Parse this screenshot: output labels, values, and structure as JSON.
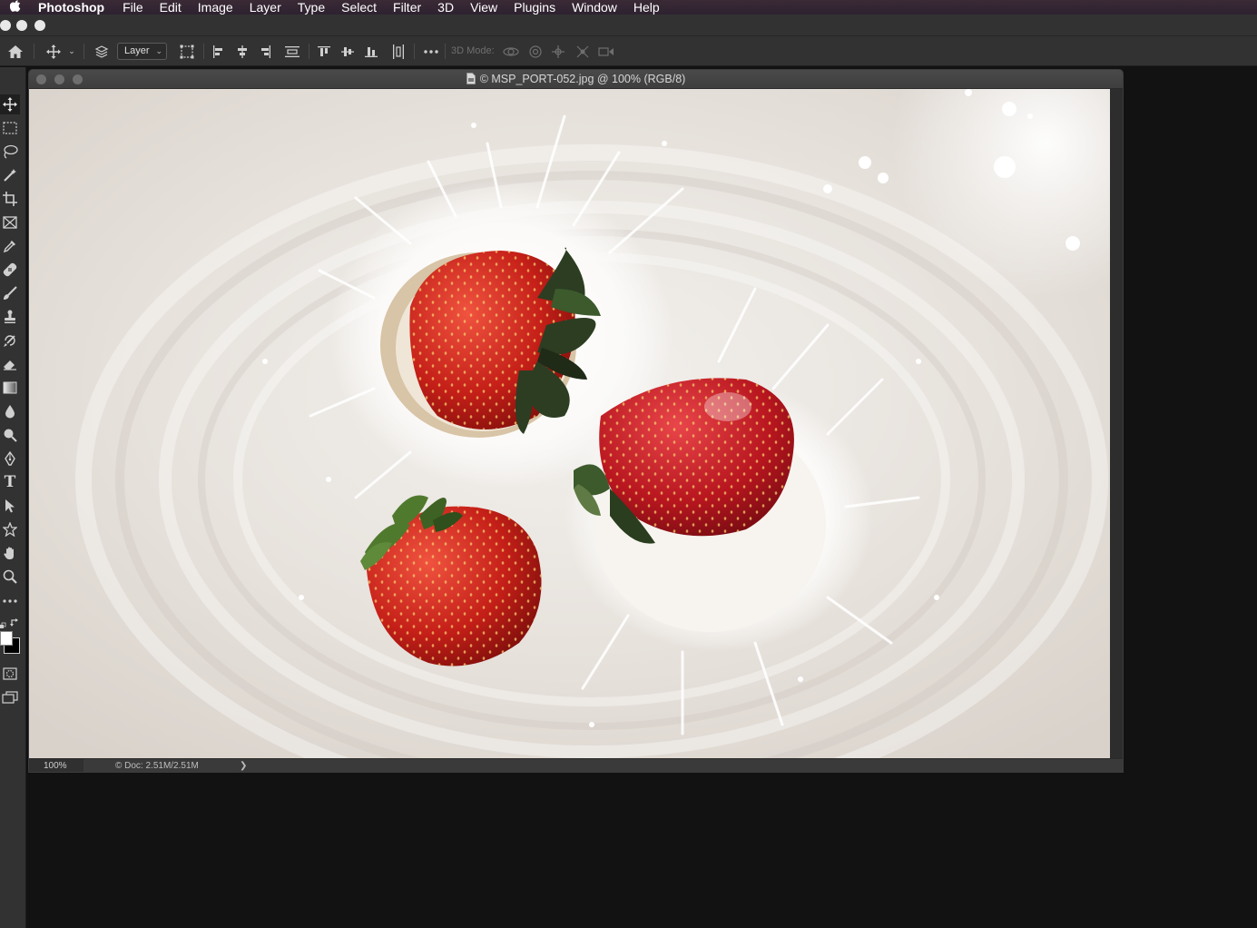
{
  "menubar": {
    "apple_icon": "apple-logo-icon",
    "app_name": "Photoshop",
    "items": [
      "File",
      "Edit",
      "Image",
      "Layer",
      "Type",
      "Select",
      "Filter",
      "3D",
      "View",
      "Plugins",
      "Window",
      "Help"
    ]
  },
  "options_bar": {
    "auto_select_target": "Layer",
    "mode_3d_label": "3D Mode:",
    "icons": [
      "home-icon",
      "move-tool-icon",
      "auto-select-layers-icon",
      "transform-controls-icon",
      "align-left-icon",
      "align-horizontal-center-icon",
      "align-right-icon",
      "distribute-vertical-icon",
      "align-top-icon",
      "align-vertical-center-icon",
      "align-bottom-icon",
      "distribute-horizontal-icon",
      "more-options-icon",
      "orbit-3d-icon",
      "roll-3d-icon",
      "pan-3d-icon",
      "slide-3d-icon",
      "scale-3d-icon"
    ]
  },
  "toolbar": {
    "tools": [
      "move-tool",
      "rectangular-marquee-tool",
      "lasso-tool",
      "magic-wand-tool",
      "crop-tool",
      "frame-tool",
      "eyedropper-tool",
      "healing-brush-tool",
      "brush-tool",
      "clone-stamp-tool",
      "history-brush-tool",
      "eraser-tool",
      "gradient-tool",
      "blur-tool",
      "dodge-tool",
      "pen-tool",
      "type-tool",
      "path-selection-tool",
      "custom-shape-tool",
      "hand-tool",
      "zoom-tool",
      "edit-toolbar",
      "default-colors",
      "swap-colors",
      "foreground-color",
      "background-color",
      "quick-mask-mode",
      "screen-mode"
    ],
    "type_tool_glyph": "T",
    "foreground_color": "#ffffff",
    "background_color": "#000000"
  },
  "document": {
    "title": "© MSP_PORT-052.jpg @ 100% (RGB/8)",
    "zoom": "100%",
    "doc_info": "© Doc: 2.51M/2.51M",
    "status_arrow": "❯",
    "image_description_icon": "strawberries-milk-splash-photo"
  }
}
